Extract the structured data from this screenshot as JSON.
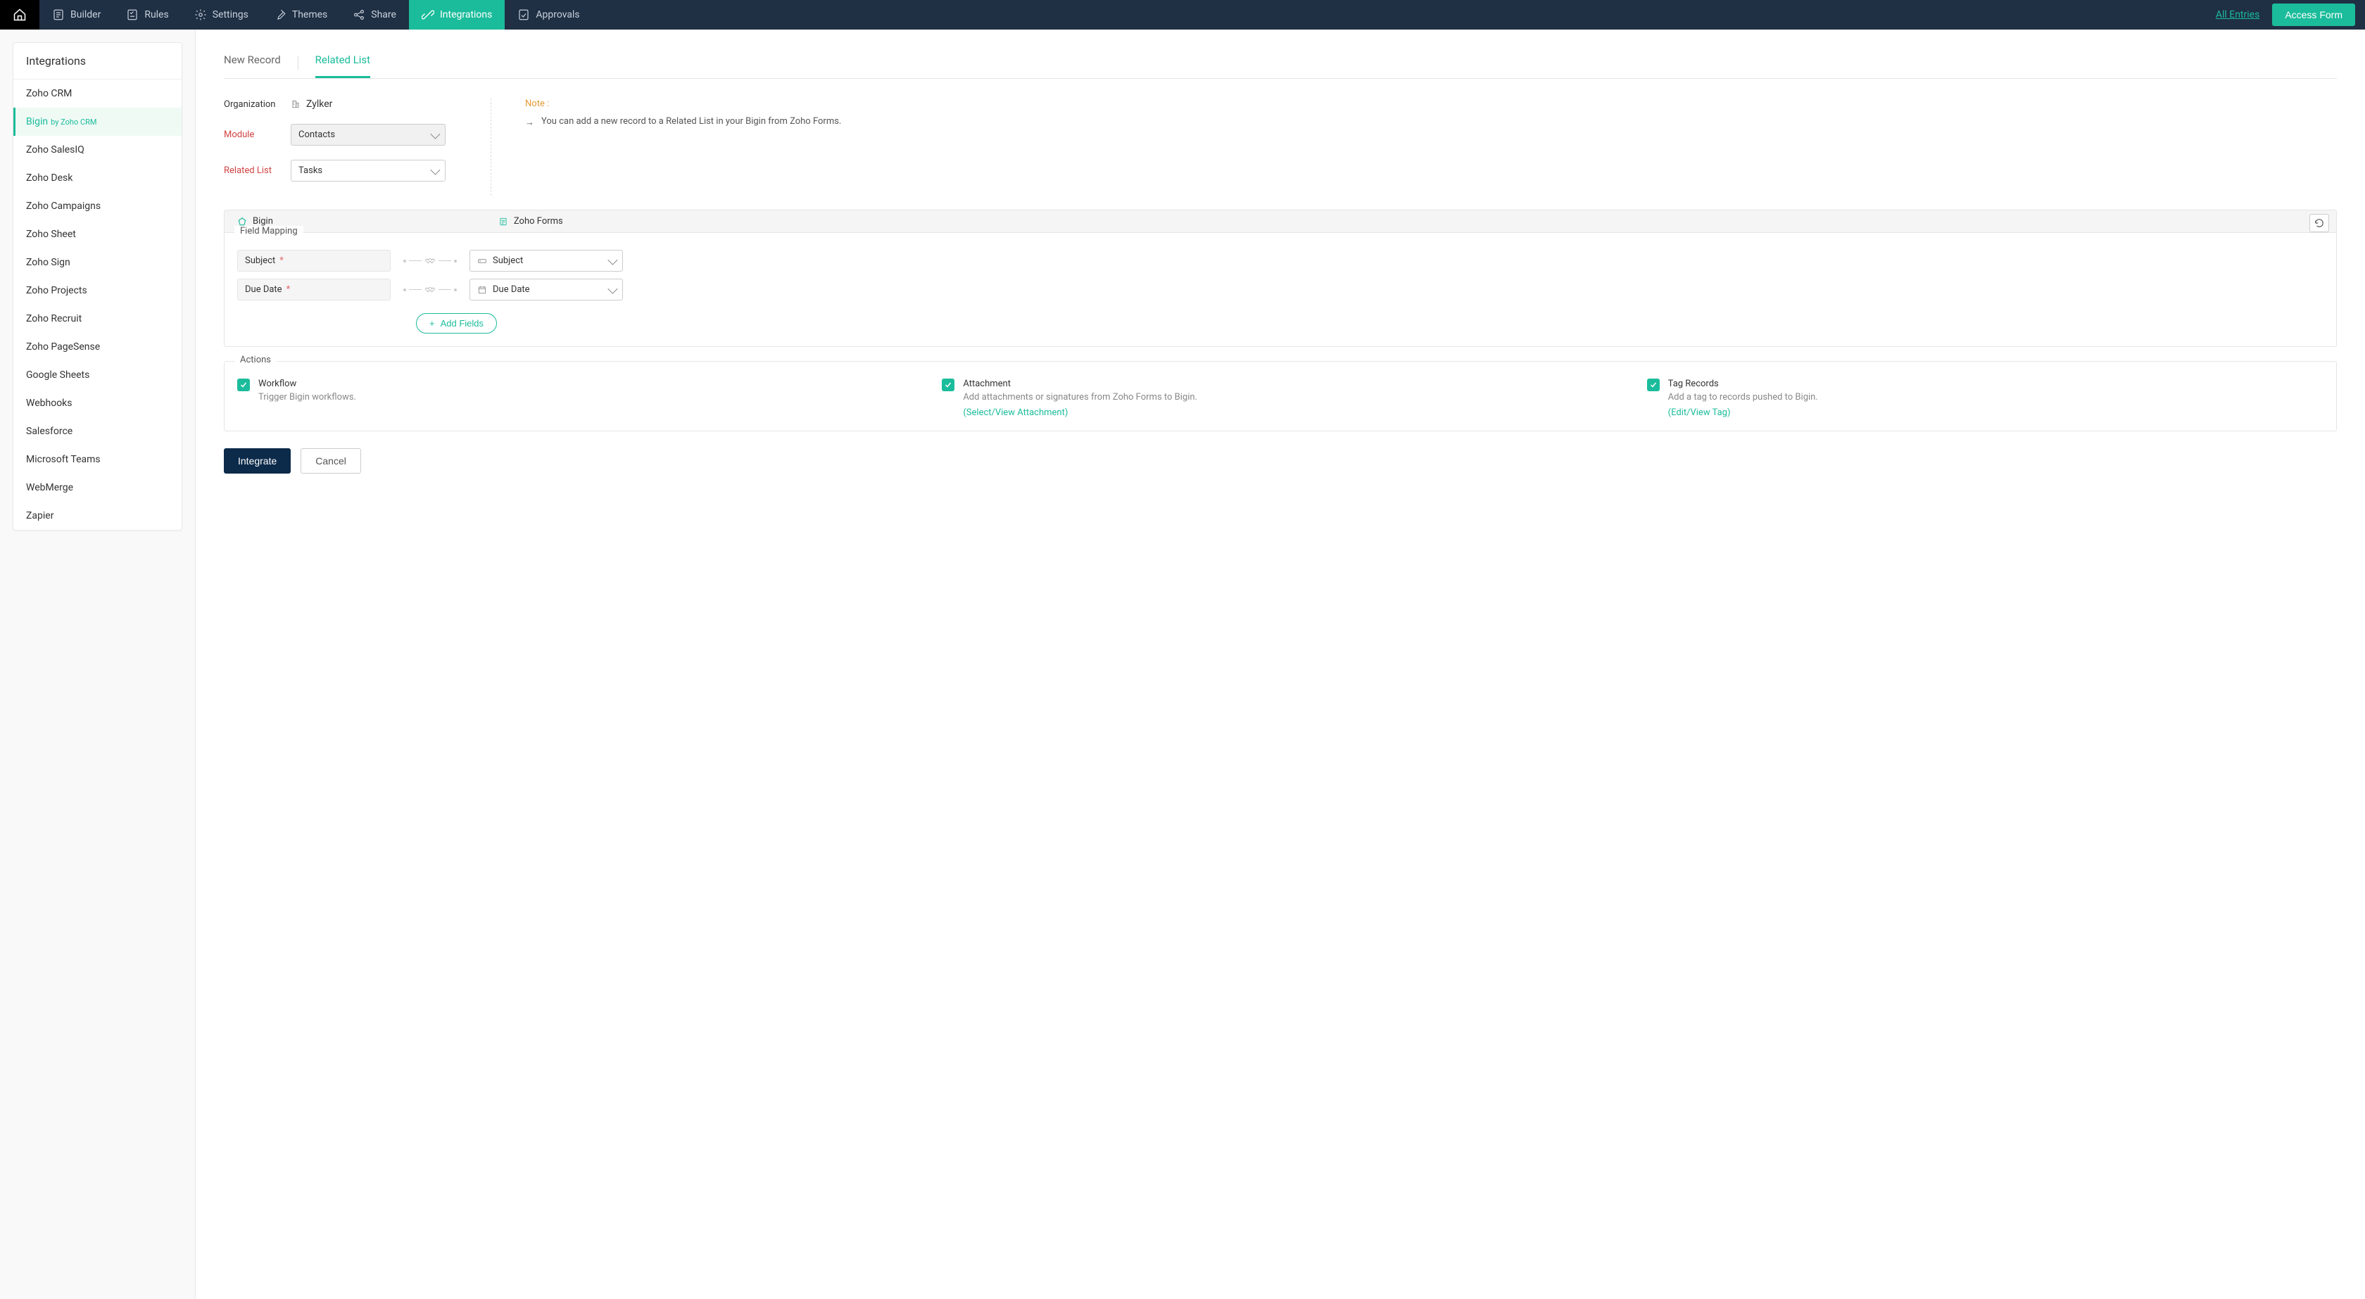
{
  "topnav": {
    "items": [
      {
        "label": "Builder"
      },
      {
        "label": "Rules"
      },
      {
        "label": "Settings"
      },
      {
        "label": "Themes"
      },
      {
        "label": "Share"
      },
      {
        "label": "Integrations"
      },
      {
        "label": "Approvals"
      }
    ],
    "all_entries": "All Entries",
    "access_form": "Access Form"
  },
  "sidebar": {
    "title": "Integrations",
    "items": [
      {
        "label": "Zoho CRM"
      },
      {
        "label": "Bigin",
        "sub": "by Zoho CRM"
      },
      {
        "label": "Zoho SalesIQ"
      },
      {
        "label": "Zoho Desk"
      },
      {
        "label": "Zoho Campaigns"
      },
      {
        "label": "Zoho Sheet"
      },
      {
        "label": "Zoho Sign"
      },
      {
        "label": "Zoho Projects"
      },
      {
        "label": "Zoho Recruit"
      },
      {
        "label": "Zoho PageSense"
      },
      {
        "label": "Google Sheets"
      },
      {
        "label": "Webhooks"
      },
      {
        "label": "Salesforce"
      },
      {
        "label": "Microsoft Teams"
      },
      {
        "label": "WebMerge"
      },
      {
        "label": "Zapier"
      }
    ]
  },
  "tabs": {
    "new_record": "New Record",
    "related_list": "Related List"
  },
  "config": {
    "org_label": "Organization",
    "org_value": "Zylker",
    "module_label": "Module",
    "module_value": "Contacts",
    "relatedlist_label": "Related List",
    "relatedlist_value": "Tasks"
  },
  "note": {
    "label": "Note :",
    "text": "You can add a new record to a Related List in your Bigin from Zoho Forms."
  },
  "mapping_header": {
    "left": "Bigin",
    "right": "Zoho Forms"
  },
  "mapping": {
    "legend": "Field Mapping",
    "rows": [
      {
        "bigin": "Subject",
        "form": "Subject",
        "required": true
      },
      {
        "bigin": "Due Date",
        "form": "Due Date",
        "required": true
      }
    ],
    "add_fields": "Add Fields"
  },
  "actions": {
    "legend": "Actions",
    "items": [
      {
        "title": "Workflow",
        "desc": "Trigger Bigin workflows.",
        "link": ""
      },
      {
        "title": "Attachment",
        "desc": "Add attachments or signatures from Zoho Forms to Bigin.",
        "link": "(Select/View Attachment)"
      },
      {
        "title": "Tag Records",
        "desc": "Add a tag to records pushed to Bigin.",
        "link": "(Edit/View Tag)"
      }
    ]
  },
  "footer": {
    "integrate": "Integrate",
    "cancel": "Cancel"
  }
}
